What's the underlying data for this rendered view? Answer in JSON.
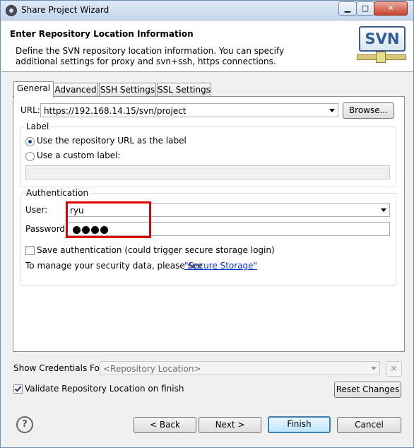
{
  "window": {
    "title": "Share Project Wizard",
    "controls": {
      "minimize_icon": "minimize-icon",
      "maximize_icon": "maximize-icon",
      "close_icon": "close-icon"
    }
  },
  "banner": {
    "heading": "Enter Repository Location Information",
    "description": "Define the SVN repository location information. You can specify additional settings for proxy and svn+ssh, https connections.",
    "logo_text": "SVN"
  },
  "tabs": [
    {
      "label": "General",
      "active": true
    },
    {
      "label": "Advanced",
      "active": false
    },
    {
      "label": "SSH Settings",
      "active": false
    },
    {
      "label": "SSL Settings",
      "active": false
    }
  ],
  "url": {
    "label": "URL:",
    "value": "https://192.168.14.15/svn/project",
    "browse_label": "Browse..."
  },
  "label_group": {
    "title": "Label",
    "option_repo": "Use the repository URL as the label",
    "option_custom": "Use a custom label:",
    "selected": "option_repo",
    "custom_value": ""
  },
  "auth": {
    "title": "Authentication",
    "user_label": "User:",
    "user_value": "ryu",
    "password_label": "Password:",
    "password_length": 4,
    "save_label": "Save authentication (could trigger secure storage login)",
    "save_checked": false,
    "manage_text": "To manage your security data, please see",
    "manage_link": "\"Secure Storage\""
  },
  "credentials": {
    "label": "Show Credentials For:",
    "placeholder": "<Repository Location>",
    "clear_icon": "close-icon"
  },
  "validate": {
    "label": "Validate Repository Location on finish",
    "checked": true
  },
  "reset_label": "Reset Changes",
  "footer": {
    "help_icon": "help-icon",
    "back_label": "< Back",
    "next_label": "Next >",
    "finish_label": "Finish",
    "cancel_label": "Cancel"
  }
}
